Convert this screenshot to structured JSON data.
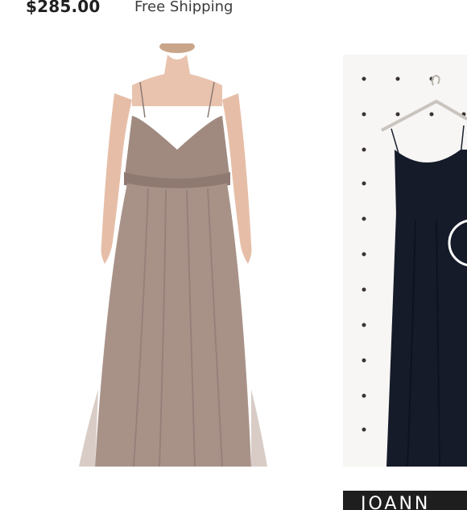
{
  "listing": {
    "price": "$285.00",
    "shipping": "Free Shipping"
  },
  "carousel": {
    "photos": [
      {
        "icon": "taupe-gown-photo"
      },
      {
        "icon": "navy-gown-photo"
      }
    ],
    "brand_text": "JOANN"
  },
  "colors": {
    "gown_main": "#a89288",
    "gown_next": "#161b2a",
    "price_text": "#1f1f1f",
    "brand_strip": "#1e1e1e"
  }
}
